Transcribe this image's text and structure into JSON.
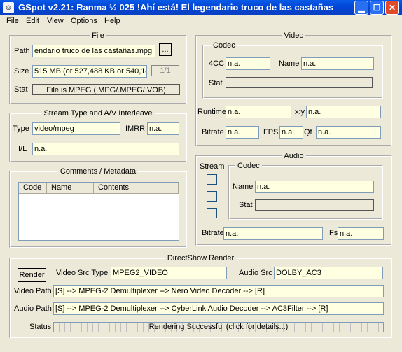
{
  "window": {
    "title": "GSpot v2.21: Ranma ½ 025 !Ahí está! El legendario truco de las castañas"
  },
  "menu": [
    "File",
    "Edit",
    "View",
    "Options",
    "Help"
  ],
  "file": {
    "legend": "File",
    "path_label": "Path",
    "path_value": "endario truco de las castañas.mpg",
    "browse_label": "...",
    "size_label": "Size",
    "size_value": "515 MB (or 527,488 KB or 540,14",
    "page_value": "1/1",
    "stat_label": "Stat",
    "stat_value": "File is MPEG (.MPG/.MPEG/.VOB)"
  },
  "stream": {
    "legend": "Stream Type and A/V Interleave",
    "type_label": "Type",
    "type_value": "video/mpeg",
    "imrr_label": "IMRR",
    "imrr_value": "n.a.",
    "il_label": "I/L",
    "il_value": "n.a."
  },
  "comments": {
    "legend": "Comments / Metadata",
    "columns": [
      "Code",
      "Name",
      "Contents"
    ]
  },
  "video": {
    "legend": "Video",
    "codec_legend": "Codec",
    "fourcc_label": "4CC",
    "fourcc_value": "n.a.",
    "name_label": "Name",
    "name_value": "n.a.",
    "stat_label": "Stat",
    "runtime_label": "Runtime",
    "runtime_value": "n.a.",
    "xy_label": "x:y",
    "xy_value": "n.a.",
    "bitrate_label": "Bitrate",
    "bitrate_value": "n.a.",
    "fps_label": "FPS",
    "fps_value": "n.a.",
    "qf_label": "Qf",
    "qf_value": "n.a."
  },
  "audio": {
    "legend": "Audio",
    "stream_label": "Stream",
    "codec_legend": "Codec",
    "name_label": "Name",
    "name_value": "n.a.",
    "stat_label": "Stat",
    "bitrate_label": "Bitrate",
    "bitrate_value": "n.a.",
    "fs_label": "Fs",
    "fs_value": "n.a."
  },
  "render": {
    "legend": "DirectShow Render",
    "render_button": "Render",
    "video_src_label": "Video Src Type",
    "video_src_value": "MPEG2_VIDEO",
    "audio_src_label": "Audio Src",
    "audio_src_value": "DOLBY_AC3",
    "video_path_label": "Video Path",
    "video_path_value": "[S] --> MPEG-2 Demultiplexer --> Nero Video Decoder --> [R]",
    "audio_path_label": "Audio Path",
    "audio_path_value": "[S] --> MPEG-2 Demultiplexer --> CyberLink Audio Decoder --> AC3Filter --> [R]",
    "status_label": "Status",
    "status_value": "Rendering Successful  (click for details...)"
  }
}
